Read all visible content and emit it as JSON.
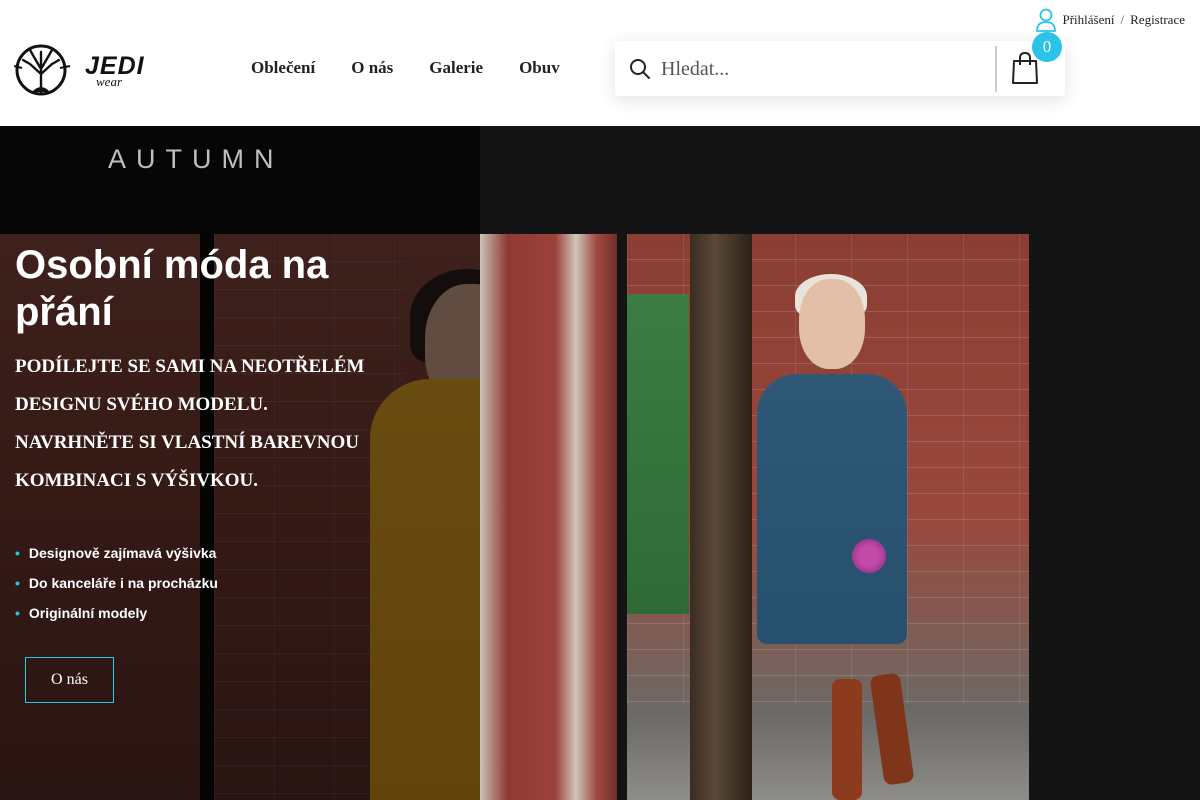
{
  "header": {
    "logo": {
      "brand": "JEDI",
      "sub": "wear"
    },
    "nav": [
      {
        "label": "Oblečení"
      },
      {
        "label": "O nás"
      },
      {
        "label": "Galerie"
      },
      {
        "label": "Obuv"
      }
    ],
    "account": {
      "login": "Přihlášení",
      "separator": "/",
      "register": "Registrace"
    },
    "search": {
      "placeholder": "Hledat..."
    },
    "cart": {
      "count": "0"
    }
  },
  "hero": {
    "banner_text": "AUTUMN",
    "title": "Osobní móda na přání",
    "subtitle_lines": [
      "Podílejte se sami na neotřelém",
      "designu svého modelu.",
      "Navrhněte si vlastní barevnou",
      "kombinaci s výšivkou."
    ],
    "bullets": [
      "Designově zajímavá výšivka",
      "Do kanceláře i na procházku",
      "Originální modely"
    ],
    "button_label": "O nás"
  },
  "colors": {
    "accent": "#2bc4e8",
    "text_dark": "#222222",
    "hero_bg": "#141414"
  }
}
